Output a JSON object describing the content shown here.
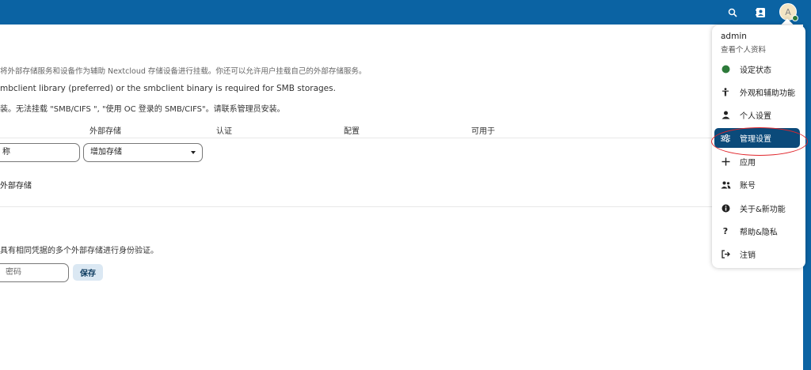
{
  "header": {
    "search_icon": "search-icon",
    "contacts_icon": "contacts-icon",
    "avatar_letter": "A",
    "status_color": "#2d7a3a"
  },
  "main": {
    "intro_text": "将外部存储服务和设备作为辅助 Nextcloud 存储设备进行挂载。你还可以允许用户挂载自己的外部存储服务。",
    "smb_notice": "mbclient library (preferred) or the smbclient binary is required for SMB storages.",
    "smb_warning": "装。无法挂载 \"SMB/CIFS \", \"使用 OC 登录的 SMB/CIFS\"。请联系管理员安装。",
    "table": {
      "columns": [
        "外部存储",
        "认证",
        "配置",
        "可用于"
      ],
      "name_input_value": "称",
      "add_storage_select": "增加存储"
    },
    "allow_user_mount_label": "外部存储",
    "global_creds_text": "具有相同凭据的多个外部存储进行身份验证。",
    "password_placeholder": "密码",
    "save_label": "保存"
  },
  "menu": {
    "username": "admin",
    "view_profile": "查看个人资料",
    "items": [
      {
        "label": "设定状态",
        "icon": "status-dot-icon"
      },
      {
        "label": "外观和辅助功能",
        "icon": "accessibility-icon"
      },
      {
        "label": "个人设置",
        "icon": "person-icon"
      },
      {
        "label": "管理设置",
        "icon": "admin-settings-icon",
        "active": true
      },
      {
        "label": "应用",
        "icon": "plus-icon"
      },
      {
        "label": "账号",
        "icon": "accounts-icon"
      },
      {
        "label": "关于&新功能",
        "icon": "info-icon"
      },
      {
        "label": "帮助&隐私",
        "icon": "help-icon"
      },
      {
        "label": "注销",
        "icon": "logout-icon"
      }
    ]
  },
  "colors": {
    "header_bg": "#0b63a3",
    "active_item_bg": "#0b4a7a",
    "highlight": "#e0252b"
  }
}
